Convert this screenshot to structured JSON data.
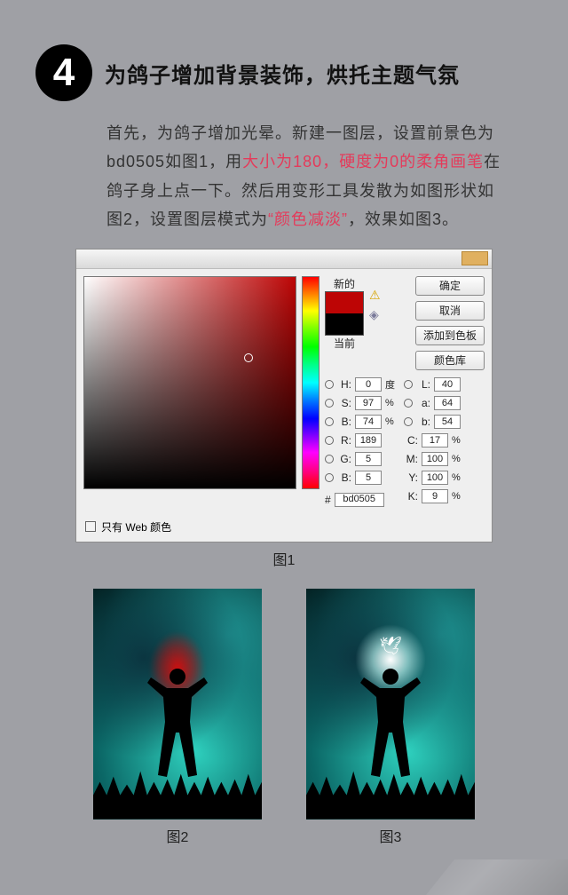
{
  "step": {
    "number": "4",
    "title": "为鸽子增加背景装饰，烘托主题气氛"
  },
  "intro": {
    "p1a": "首先，为鸽子增加光晕。新建一图层，设置前景色为bd0505如图1，用",
    "p1hl1": "大小为180，硬度为0的柔角画笔",
    "p1b": "在鸽子身上点一下。然后用变形工具发散为如图形状如图2，设置图层模式为",
    "p1hl2": "“颜色减淡”",
    "p1c": "，效果如图3。"
  },
  "cp": {
    "labels": {
      "new": "新的",
      "current": "当前",
      "webOnly": "只有 Web 颜色"
    },
    "buttons": {
      "ok": "确定",
      "cancel": "取消",
      "addSwatch": "添加到色板",
      "colorLib": "颜色库"
    },
    "fields": {
      "H": {
        "label": "H:",
        "value": "0",
        "unit": "度"
      },
      "S": {
        "label": "S:",
        "value": "97",
        "unit": "%"
      },
      "Bv": {
        "label": "B:",
        "value": "74",
        "unit": "%"
      },
      "R": {
        "label": "R:",
        "value": "189"
      },
      "G": {
        "label": "G:",
        "value": "5"
      },
      "Bb": {
        "label": "B:",
        "value": "5"
      },
      "L": {
        "label": "L:",
        "value": "40"
      },
      "a": {
        "label": "a:",
        "value": "64"
      },
      "b": {
        "label": "b:",
        "value": "54"
      },
      "C": {
        "label": "C:",
        "value": "17",
        "unit": "%"
      },
      "M": {
        "label": "M:",
        "value": "100",
        "unit": "%"
      },
      "Y": {
        "label": "Y:",
        "value": "100",
        "unit": "%"
      },
      "K": {
        "label": "K:",
        "value": "9",
        "unit": "%"
      },
      "hex": {
        "label": "#",
        "value": "bd0505"
      }
    }
  },
  "captions": {
    "fig1": "图1",
    "fig2": "图2",
    "fig3": "图3"
  }
}
